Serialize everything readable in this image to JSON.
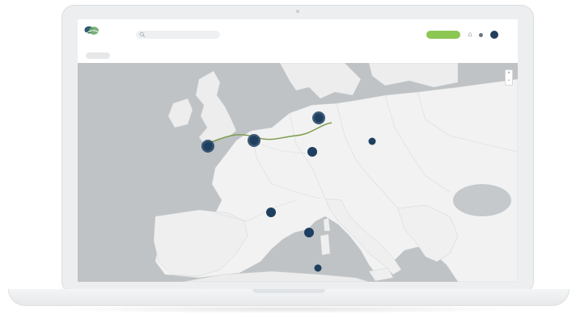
{
  "app": {
    "logo_text": "",
    "search_placeholder": "",
    "nav": [
      {
        "label": ""
      },
      {
        "label": ""
      },
      {
        "label": ""
      }
    ],
    "cta_label": "",
    "filters": [
      {
        "label": ""
      },
      {
        "label": ""
      },
      {
        "label": ""
      }
    ]
  },
  "map": {
    "clusters": [
      {
        "id": "uk",
        "count": ""
      },
      {
        "id": "belgium",
        "count": ""
      },
      {
        "id": "germany-north",
        "count": ""
      },
      {
        "id": "germany-south",
        "count": ""
      },
      {
        "id": "poland",
        "count": ""
      },
      {
        "id": "italy-north",
        "count": ""
      },
      {
        "id": "italy-central",
        "count": ""
      },
      {
        "id": "sicily",
        "count": ""
      }
    ],
    "zoom_in": "+",
    "zoom_out": "−"
  },
  "colors": {
    "accent": "#8cc653",
    "marker": "#1f3f60",
    "land": "#f2f2f2",
    "sea": "#bfc3c6",
    "route": "#7a9a4a"
  },
  "icons": {
    "logo": "leaf-logo-icon",
    "search": "search-icon",
    "notifications": "bell-icon",
    "profile": "avatar"
  }
}
